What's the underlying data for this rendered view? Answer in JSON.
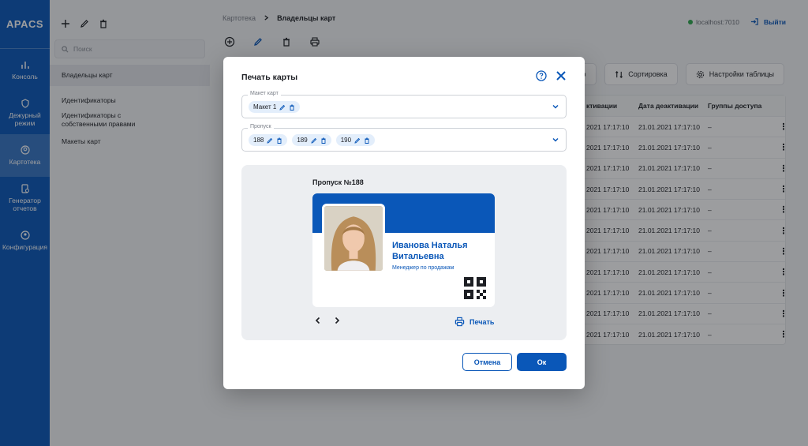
{
  "app": {
    "logo": "APACS"
  },
  "rail": [
    {
      "label": "Консоль",
      "icon": "bar-chart-icon"
    },
    {
      "label": "Дежурный режим",
      "icon": "shield-icon"
    },
    {
      "label": "Картотека",
      "icon": "person-circle-icon"
    },
    {
      "label": "Генератор отчетов",
      "icon": "report-icon"
    },
    {
      "label": "Конфигурация",
      "icon": "gear-person-icon"
    }
  ],
  "subnav": {
    "search_placeholder": "Поиск",
    "items": [
      "Владельцы карт",
      "Идентификаторы",
      "Идентификаторы с собственными правами",
      "Макеты карт"
    ]
  },
  "breadcrumb": {
    "root": "Картотека",
    "current": "Владельцы карт"
  },
  "header": {
    "host": "localhost:7010",
    "logout": "Выйти"
  },
  "buttons": {
    "filter_partial": "тр",
    "sort": "Сортировка",
    "table_settings": "Настройки таблицы"
  },
  "table": {
    "headers": [
      "ктивации",
      "Дата деактивации",
      "Группы доступа"
    ],
    "rows": [
      [
        "2021 17:17:10",
        "21.01.2021 17:17:10",
        "–"
      ],
      [
        "2021 17:17:10",
        "21.01.2021 17:17:10",
        "–"
      ],
      [
        "2021 17:17:10",
        "21.01.2021 17:17:10",
        "–"
      ],
      [
        "2021 17:17:10",
        "21.01.2021 17:17:10",
        "–"
      ],
      [
        "2021 17:17:10",
        "21.01.2021 17:17:10",
        "–"
      ],
      [
        "2021 17:17:10",
        "21.01.2021 17:17:10",
        "–"
      ],
      [
        "2021 17:17:10",
        "21.01.2021 17:17:10",
        "–"
      ],
      [
        "2021 17:17:10",
        "21.01.2021 17:17:10",
        "–"
      ],
      [
        "2021 17:17:10",
        "21.01.2021 17:17:10",
        "–"
      ],
      [
        "2021 17:17:10",
        "21.01.2021 17:17:10",
        "–"
      ],
      [
        "2021 17:17:10",
        "21.01.2021 17:17:10",
        "–"
      ]
    ]
  },
  "modal": {
    "title": "Печать карты",
    "layout_field": {
      "legend": "Макет карт",
      "chips": [
        "Макет 1"
      ]
    },
    "pass_field": {
      "legend": "Пропуск",
      "chips": [
        "188",
        "189",
        "190"
      ]
    },
    "preview": {
      "title": "Пропуск №188",
      "name": "Иванова Наталья Витальевна",
      "role": "Менеджер по продажам",
      "print": "Печать"
    },
    "cancel": "Отмена",
    "ok": "Ок"
  },
  "colors": {
    "brand": "#0a57b8",
    "online": "#2fa84f"
  }
}
